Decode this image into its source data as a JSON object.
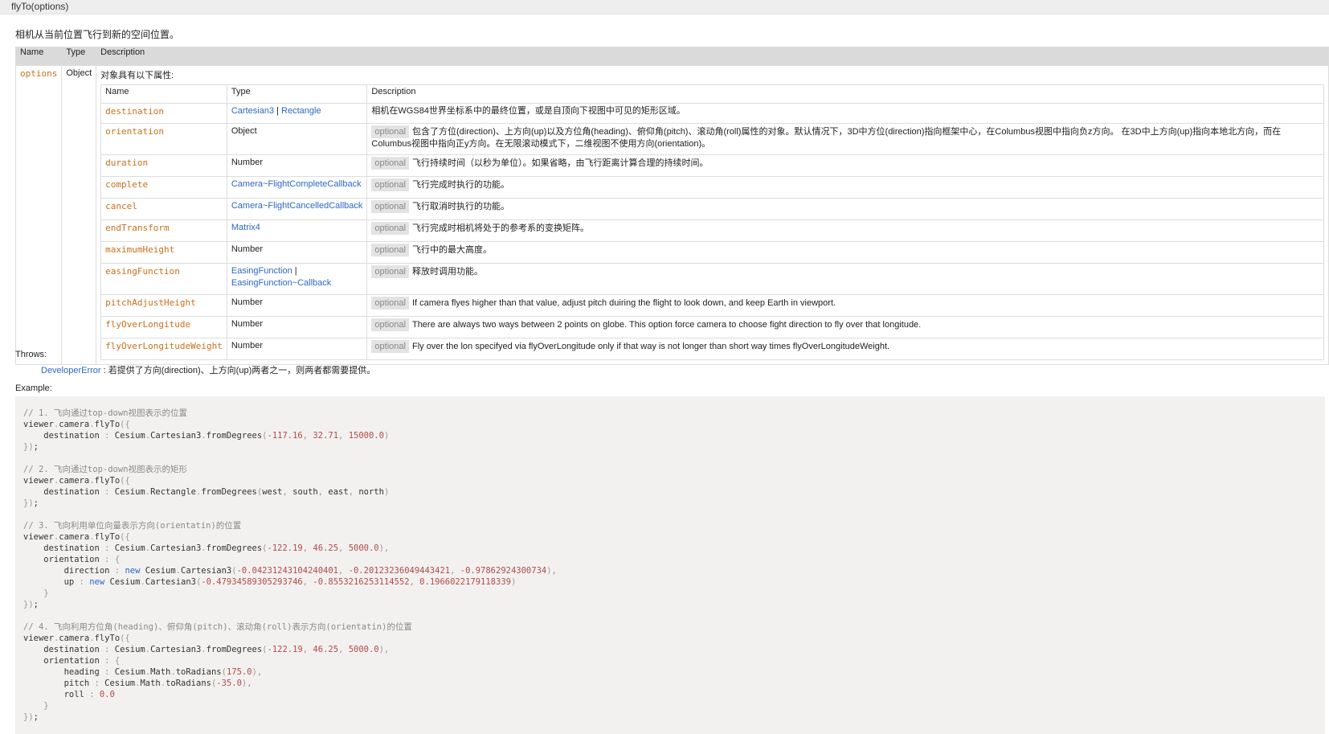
{
  "title": "flyTo(options)",
  "summary": "相机从当前位置飞行到新的空间位置。",
  "params_header": {
    "name": "Name",
    "type": "Type",
    "description": "Description"
  },
  "options_param": {
    "name": "options",
    "type": "Object",
    "intro": "对象具有以下属性:"
  },
  "props_header": {
    "name": "Name",
    "type": "Type",
    "description": "Description"
  },
  "optional_label": "optional",
  "props": [
    {
      "name": "destination",
      "types": [
        {
          "text": "Cartesian3",
          "link": true
        },
        {
          "text": " | ",
          "link": false
        },
        {
          "text": "Rectangle",
          "link": true
        }
      ],
      "optional": false,
      "desc": "相机在WGS84世界坐标系中的最终位置，或是自顶向下视图中可见的矩形区域。"
    },
    {
      "name": "orientation",
      "types": [
        {
          "text": "Object",
          "link": false
        }
      ],
      "optional": true,
      "desc": "包含了方位(direction)、上方向(up)以及方位角(heading)、俯仰角(pitch)、滚动角(roll)属性的对象。默认情况下，3D中方位(direction)指向框架中心，在Columbus视图中指向负z方向。 在3D中上方向(up)指向本地北方向，而在Columbus视图中指向正y方向。在无限滚动模式下，二维视图不使用方向(orientation)。"
    },
    {
      "name": "duration",
      "types": [
        {
          "text": "Number",
          "link": false
        }
      ],
      "optional": true,
      "desc": "飞行持续时间（以秒为单位）。如果省略，由飞行距离计算合理的持续时间。"
    },
    {
      "name": "complete",
      "types": [
        {
          "text": "Camera~FlightCompleteCallback",
          "link": true
        }
      ],
      "optional": true,
      "desc": "飞行完成时执行的功能。"
    },
    {
      "name": "cancel",
      "types": [
        {
          "text": "Camera~FlightCancelledCallback",
          "link": true
        }
      ],
      "optional": true,
      "desc": "飞行取消时执行的功能。"
    },
    {
      "name": "endTransform",
      "types": [
        {
          "text": "Matrix4",
          "link": true
        }
      ],
      "optional": true,
      "desc": "飞行完成时相机将处于的参考系的变换矩阵。"
    },
    {
      "name": "maximumHeight",
      "types": [
        {
          "text": "Number",
          "link": false
        }
      ],
      "optional": true,
      "desc": "飞行中的最大高度。"
    },
    {
      "name": "easingFunction",
      "types": [
        {
          "text": "EasingFunction",
          "link": true
        },
        {
          "text": " | ",
          "link": false
        },
        {
          "text": "EasingFunction~Callback",
          "link": true
        }
      ],
      "optional": true,
      "desc": "释放时调用功能。"
    },
    {
      "name": "pitchAdjustHeight",
      "types": [
        {
          "text": "Number",
          "link": false
        }
      ],
      "optional": true,
      "desc": "If camera flyes higher than that value, adjust pitch duiring the flight to look down, and keep Earth in viewport."
    },
    {
      "name": "flyOverLongitude",
      "types": [
        {
          "text": "Number",
          "link": false
        }
      ],
      "optional": true,
      "desc": "There are always two ways between 2 points on globe. This option force camera to choose fight direction to fly over that longitude."
    },
    {
      "name": "flyOverLongitudeWeight",
      "types": [
        {
          "text": "Number",
          "link": false
        }
      ],
      "optional": true,
      "desc": "Fly over the lon specifyed via flyOverLongitude only if that way is not longer than short way times flyOverLongitudeWeight."
    }
  ],
  "throws": {
    "label": "Throws:",
    "error_type": "DeveloperError",
    "separator": " : ",
    "message": "若提供了方向(direction)、上方向(up)两者之一，则两者都需要提供。"
  },
  "example_label": "Example:",
  "code_lines": [
    "// 1. 飞向通过top-down视图表示的位置",
    "viewer.camera.flyTo({",
    "    destination : Cesium.Cartesian3.fromDegrees(-117.16, 32.71, 15000.0)",
    "});",
    "",
    "// 2. 飞向通过top-down视图表示的矩形",
    "viewer.camera.flyTo({",
    "    destination : Cesium.Rectangle.fromDegrees(west, south, east, north)",
    "});",
    "",
    "// 3. 飞向利用单位向量表示方向(orientatin)的位置",
    "viewer.camera.flyTo({",
    "    destination : Cesium.Cartesian3.fromDegrees(-122.19, 46.25, 5000.0),",
    "    orientation : {",
    "        direction : new Cesium.Cartesian3(-0.04231243104240401, -0.20123236049443421, -0.97862924300734),",
    "        up : new Cesium.Cartesian3(-0.47934589305293746, -0.8553216253114552, 0.1966022179118339)",
    "    }",
    "});",
    "",
    "// 4. 飞向利用方位角(heading)、俯仰角(pitch)、滚动角(roll)表示方向(orientatin)的位置",
    "viewer.camera.flyTo({",
    "    destination : Cesium.Cartesian3.fromDegrees(-122.19, 46.25, 5000.0),",
    "    orientation : {",
    "        heading : Cesium.Math.toRadians(175.0),",
    "        pitch : Cesium.Math.toRadians(-35.0),",
    "        roll : 0.0",
    "    }",
    "});"
  ]
}
